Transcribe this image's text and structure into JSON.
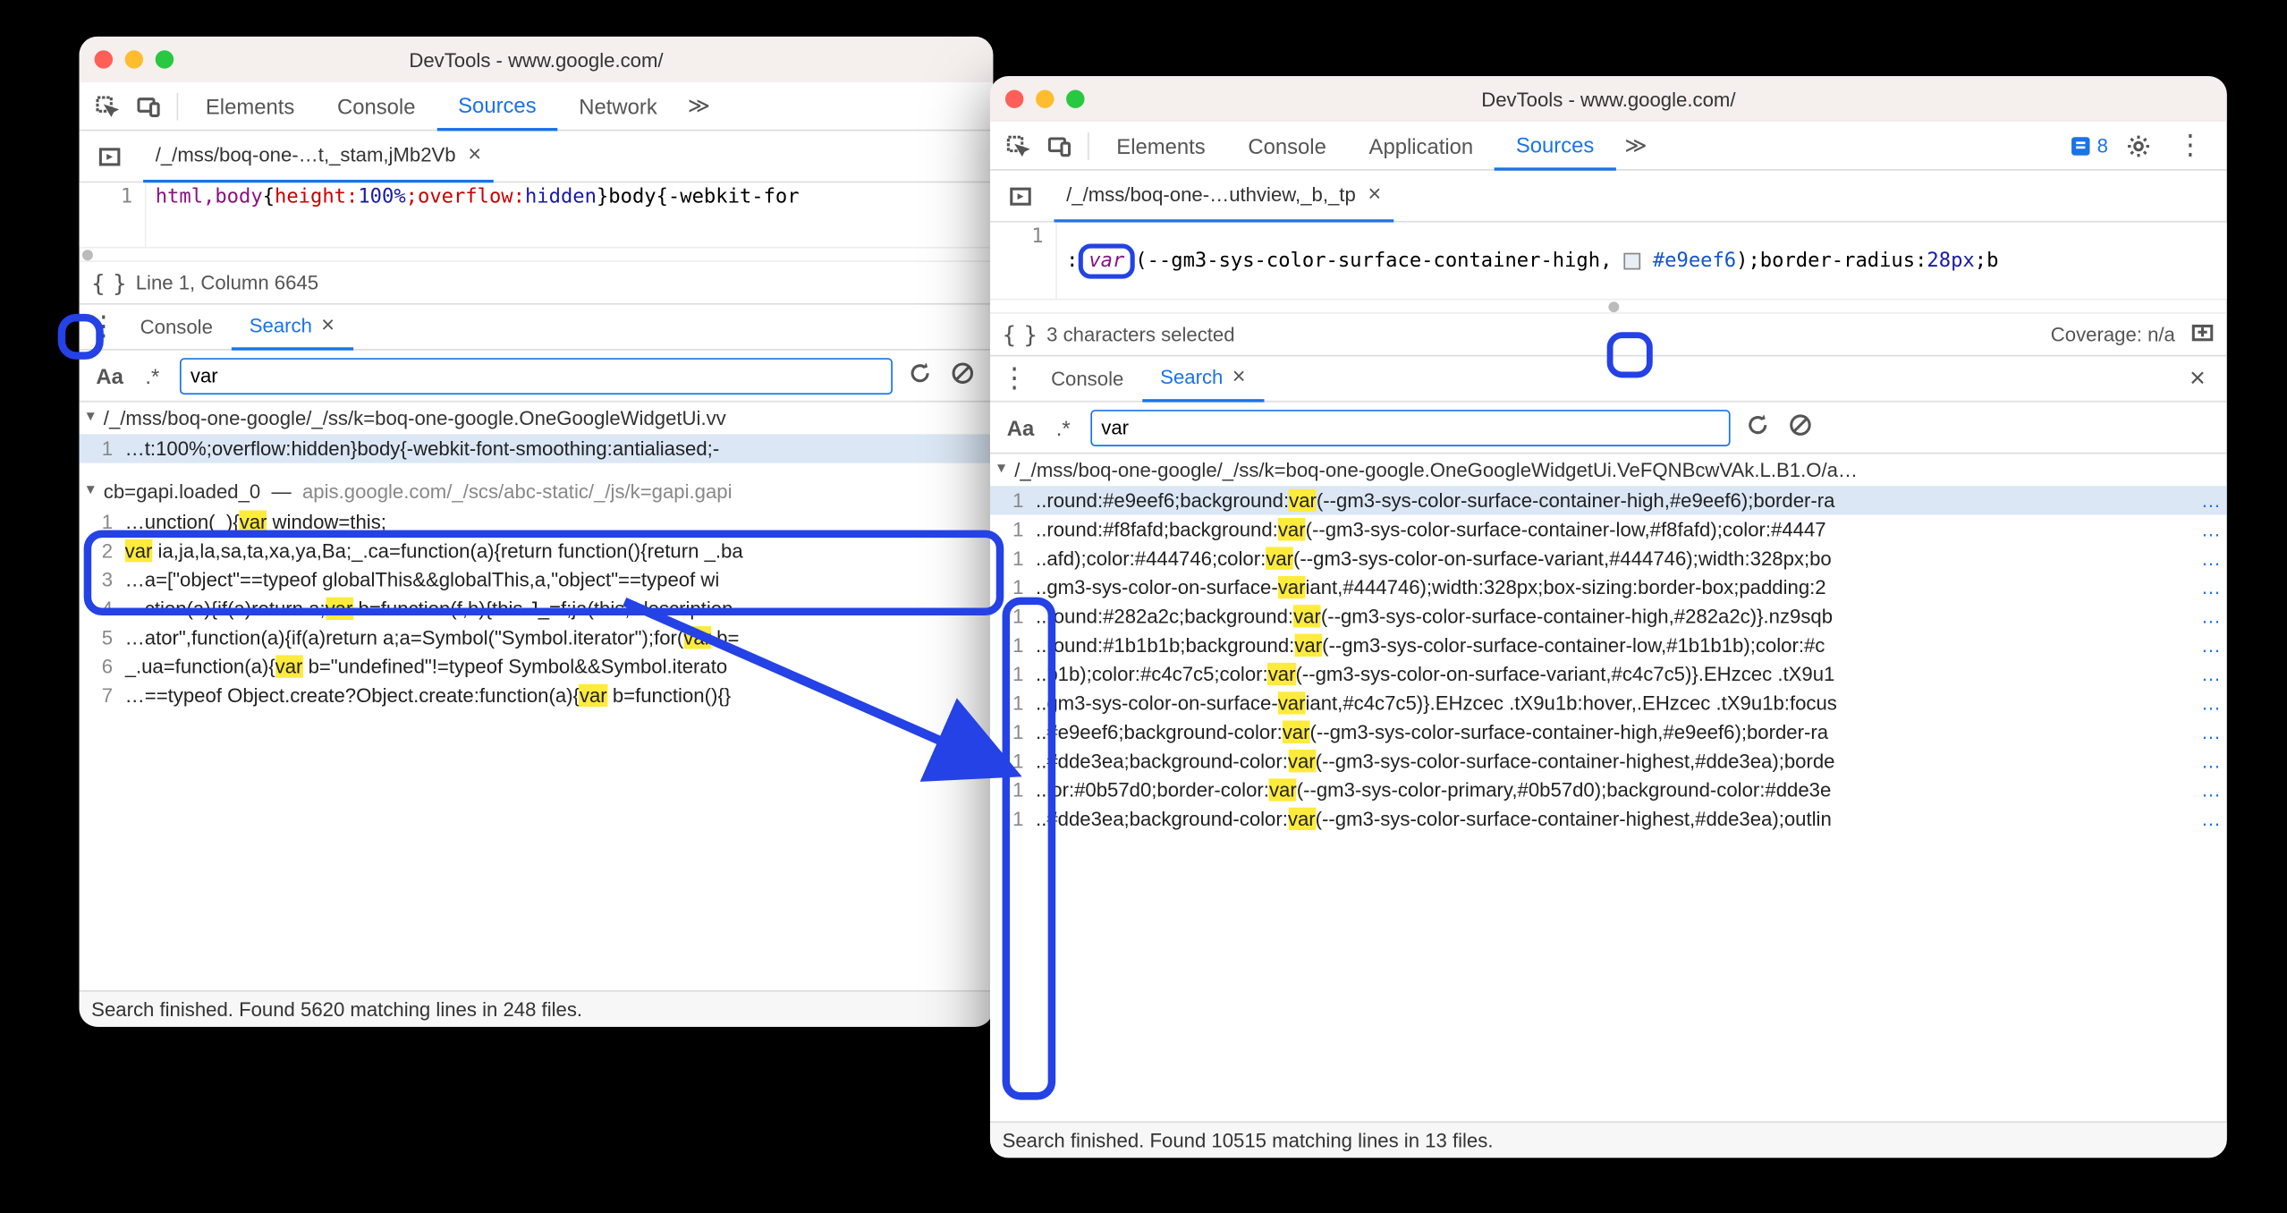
{
  "left": {
    "title": "DevTools - www.google.com/",
    "tabs": [
      "Elements",
      "Console",
      "Sources",
      "Network"
    ],
    "active_tab": "Sources",
    "overflow": "≫",
    "file_tab": "/_/mss/boq-one-…t,_stam,jMb2Vb",
    "code": {
      "line_no": "1",
      "seg_sel": "html,body",
      "seg_prop1": "height:",
      "seg_val1": "100%",
      "seg_prop2": ";overflow:",
      "seg_val2": "hidden",
      "seg_after": "}body{-webkit-for"
    },
    "status": "Line 1, Column 6645",
    "drawer": {
      "console": "Console",
      "search": "Search"
    },
    "search": {
      "aa": "Aa",
      "re": ".*",
      "value": "var"
    },
    "results": {
      "file1": "/_/mss/boq-one-google/_/ss/k=boq-one-google.OneGoogleWidgetUi.vv",
      "line1": {
        "n": "1",
        "t": "…t:100%;overflow:hidden}body{-webkit-font-smoothing:antialiased;-"
      },
      "file2_a": "cb=gapi.loaded_0",
      "file2_b": "apis.google.com/_/scs/abc-static/_/js/k=gapi.gapi",
      "lines2": [
        {
          "n": "1",
          "pre": "…unction(_){",
          "m": "var",
          "post": " window=this;"
        },
        {
          "n": "2",
          "pre": "",
          "m": "var",
          "post": " ia,ja,la,sa,ta,xa,ya,Ba;_.ca=function(a){return function(){return _.ba"
        },
        {
          "n": "3",
          "pre": "…a=[\"object\"==typeof globalThis&&globalThis,a,\"object\"==typeof wi",
          "m": "",
          "post": ""
        },
        {
          "n": "4",
          "pre": "…ction(a){if(a)return a;",
          "m": "var",
          "post": " b=function(f,h){this.J_=f;ja(this,\"description"
        },
        {
          "n": "5",
          "pre": "…ator\",function(a){if(a)return a;a=Symbol(\"Symbol.iterator\");for(",
          "m": "var",
          "post": " b="
        },
        {
          "n": "6",
          "pre": "_.ua=function(a){",
          "m": "var",
          "post": " b=\"undefined\"!=typeof Symbol&&Symbol.iterato"
        },
        {
          "n": "7",
          "pre": "…==typeof Object.create?Object.create:function(a){",
          "m": "var",
          "post": " b=function(){}"
        }
      ]
    },
    "footer": "Search finished.  Found 5620 matching lines in 248 files."
  },
  "right": {
    "title": "DevTools - www.google.com/",
    "tabs": [
      "Elements",
      "Console",
      "Application",
      "Sources"
    ],
    "active_tab": "Sources",
    "overflow": "≫",
    "badge_count": "8",
    "file_tab": "/_/mss/boq-one-…uthview,_b,_tp",
    "code": {
      "line_no": "1",
      "pre": ":",
      "func": "var",
      "mid1": "(--gm3-sys-color-surface-container-high,",
      "hex": "#e9eef6",
      "mid2": ");border-radius:",
      "px": "28px",
      "post": ";b"
    },
    "status_left": "3 characters selected",
    "status_right": "Coverage: n/a",
    "drawer": {
      "console": "Console",
      "search": "Search"
    },
    "search": {
      "aa": "Aa",
      "re": ".*",
      "value": "var"
    },
    "results": {
      "file1": "/_/mss/boq-one-google/_/ss/k=boq-one-google.OneGoogleWidgetUi.VeFQNBcwVAk.L.B1.O/a…",
      "lines": [
        {
          "n": "1",
          "pre": "..round:#e9eef6;background:",
          "m": "var",
          "post": "(--gm3-sys-color-surface-container-high,#e9eef6);border-ra"
        },
        {
          "n": "1",
          "pre": "..round:#f8fafd;background:",
          "m": "var",
          "post": "(--gm3-sys-color-surface-container-low,#f8fafd);color:#4447"
        },
        {
          "n": "1",
          "pre": "..afd);color:#444746;color:",
          "m": "var",
          "post": "(--gm3-sys-color-on-surface-variant,#444746);width:328px;bo"
        },
        {
          "n": "1",
          "pre": "..gm3-sys-color-on-surface-",
          "m": "var",
          "post": "iant,#444746);width:328px;box-sizing:border-box;padding:2"
        },
        {
          "n": "1",
          "pre": "..round:#282a2c;background:",
          "m": "var",
          "post": "(--gm3-sys-color-surface-container-high,#282a2c)}.nz9sqb"
        },
        {
          "n": "1",
          "pre": "..round:#1b1b1b;background:",
          "m": "var",
          "post": "(--gm3-sys-color-surface-container-low,#1b1b1b);color:#c"
        },
        {
          "n": "1",
          "pre": "..b1b);color:#c4c7c5;color:",
          "m": "var",
          "post": "(--gm3-sys-color-on-surface-variant,#c4c7c5)}.EHzcec .tX9u1"
        },
        {
          "n": "1",
          "pre": "..gm3-sys-color-on-surface-",
          "m": "var",
          "post": "iant,#c4c7c5)}.EHzcec .tX9u1b:hover,.EHzcec .tX9u1b:focus"
        },
        {
          "n": "1",
          "pre": "..#e9eef6;background-color:",
          "m": "var",
          "post": "(--gm3-sys-color-surface-container-high,#e9eef6);border-ra"
        },
        {
          "n": "1",
          "pre": "..#dde3ea;background-color:",
          "m": "var",
          "post": "(--gm3-sys-color-surface-container-highest,#dde3ea);borde"
        },
        {
          "n": "1",
          "pre": "..lor:#0b57d0;border-color:",
          "m": "var",
          "post": "(--gm3-sys-color-primary,#0b57d0);background-color:#dde3e"
        },
        {
          "n": "1",
          "pre": "..#dde3ea;background-color:",
          "m": "var",
          "post": "(--gm3-sys-color-surface-container-highest,#dde3ea);outlin"
        }
      ]
    },
    "footer": "Search finished.  Found 10515 matching lines in 13 files."
  }
}
